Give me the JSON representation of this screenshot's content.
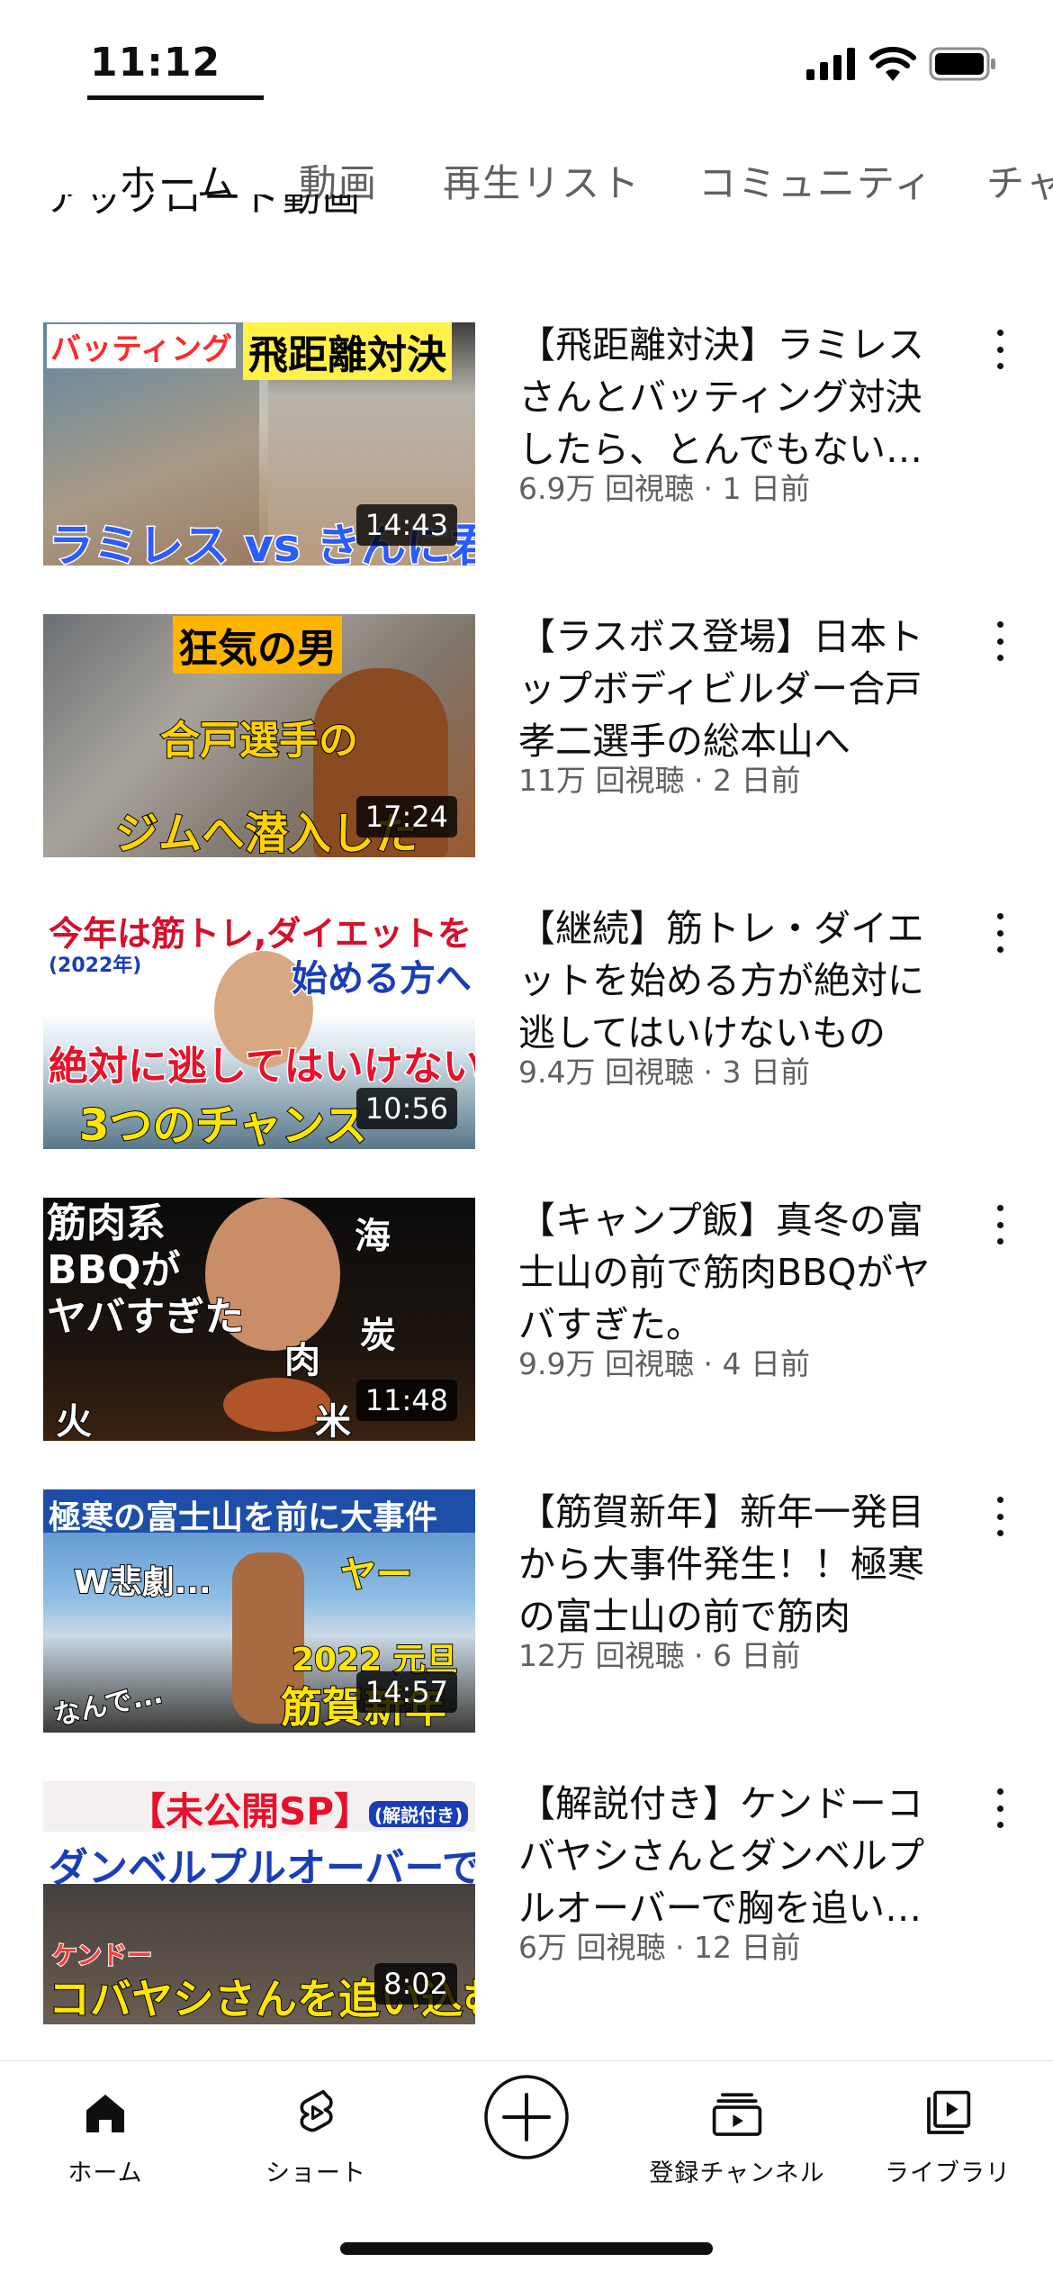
{
  "status_bar": {
    "time": "11:12"
  },
  "tabs": [
    {
      "label": "ホーム",
      "active": true
    },
    {
      "label": "動画"
    },
    {
      "label": "再生リスト"
    },
    {
      "label": "コミュニティ"
    },
    {
      "label": "チャ"
    }
  ],
  "section_header": "アップロード動画",
  "videos": [
    {
      "title": "【飛距離対決】ラミレスさんとバッティング対決したら、とんでもない結果に",
      "views": "6.9万 回視聴",
      "age": "1 日前",
      "duration": "14:43",
      "thumb_text": [
        "バッティング",
        "飛距離対決",
        "ラミレス vs きんに君"
      ]
    },
    {
      "title": "【ラスボス登場】日本トップボディビルダー合戸孝二選手の総本山へ",
      "views": "11万 回視聴",
      "age": "2 日前",
      "duration": "17:24",
      "thumb_text": [
        "狂気の男",
        "合戸選手の",
        "ジムへ潜入した"
      ]
    },
    {
      "title": "【継続】筋トレ・ダイエットを始める方が絶対に逃してはいけないもの",
      "views": "9.4万 回視聴",
      "age": "3 日前",
      "duration": "10:56",
      "thumb_text": [
        "今年は筋トレ,ダイエットを",
        "(2022年)",
        "始める方へ",
        "絶対に逃してはいけない",
        "3つのチャンス"
      ]
    },
    {
      "title": "【キャンプ飯】真冬の富士山の前で筋肉BBQがヤバすぎた。",
      "views": "9.9万 回視聴",
      "age": "4 日前",
      "duration": "11:48",
      "thumb_text": [
        "筋肉系",
        "BBQが",
        "ヤバすぎた",
        "海",
        "炭",
        "肉",
        "火",
        "米"
      ]
    },
    {
      "title": "【筋賀新年】新年一発目から大事件発生！！極寒の富士山の前で筋肉",
      "views": "12万 回視聴",
      "age": "6 日前",
      "duration": "14:57",
      "thumb_text": [
        "極寒の富士山を前に大事件",
        "W悲劇...",
        "ヤー",
        "なんで...",
        "2022 元旦",
        "筋賀新年"
      ]
    },
    {
      "title": "【解説付き】ケンドーコバヤシさんとダンベルプルオーバーで胸を追い込む",
      "views": "6万 回視聴",
      "age": "12 日前",
      "duration": "8:02",
      "thumb_text": [
        "【未公開SP】",
        "(解説付き)",
        "ダンベルプルオーバーで",
        "ケンドー",
        "コバヤシさんを追い込む"
      ]
    }
  ],
  "bottom_nav": [
    {
      "label": "ホーム",
      "icon": "home-icon"
    },
    {
      "label": "ショート",
      "icon": "shorts-icon"
    },
    {
      "label": "",
      "icon": "create-icon"
    },
    {
      "label": "登録チャンネル",
      "icon": "subscriptions-icon"
    },
    {
      "label": "ライブラリ",
      "icon": "library-icon"
    }
  ]
}
